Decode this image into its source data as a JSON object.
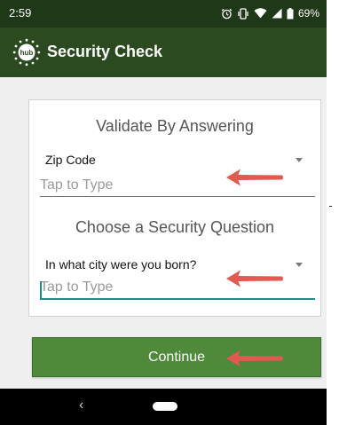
{
  "status_bar": {
    "time": "2:59",
    "battery": "69%",
    "icons": [
      "alarm-icon",
      "vibrate-icon",
      "wifi-icon",
      "signal-icon",
      "battery-icon"
    ]
  },
  "app_bar": {
    "logo_text": "hub",
    "title": "Security Check"
  },
  "form": {
    "heading_validate": "Validate By Answering",
    "zip_dropdown": {
      "selected": "Zip Code"
    },
    "zip_input": {
      "placeholder": "Tap to Type",
      "value": ""
    },
    "heading_question": "Choose a Security Question",
    "question_dropdown": {
      "selected": "In what city were you born?"
    },
    "question_input": {
      "placeholder": "Tap to Type",
      "value": ""
    }
  },
  "continue_button": {
    "label": "Continue"
  },
  "nav_bar": {
    "back_glyph": "‹"
  },
  "colors": {
    "status_bar_bg": "#1f3817",
    "app_bar_bg": "#2b4a20",
    "accent_teal": "#1b8f8a",
    "button_green": "#4e8a3a",
    "annotation_red": "#e05a52"
  }
}
